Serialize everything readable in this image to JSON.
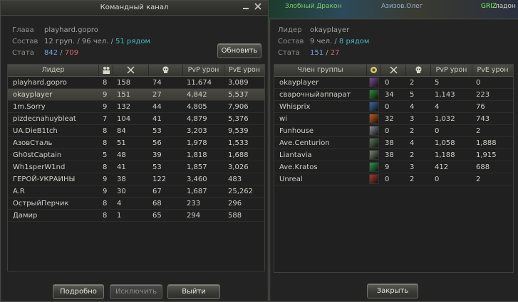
{
  "background": {
    "snippets": [
      "Злобный Дракон",
      "Азизов.Олег",
      "GRIZ",
      "ладон"
    ]
  },
  "left": {
    "title": "Командный канал",
    "info": {
      "leader_label": "Глава",
      "leader_value": "playhard.gopro",
      "composition_label": "Состав",
      "composition_value": "12 груп. / 96 чел. /",
      "composition_nearby": "51 рядом",
      "stats_label": "Стата",
      "stats_a": "842",
      "stats_sep": "/",
      "stats_b": "709"
    },
    "refresh_label": "Обновить",
    "columns": [
      "Лидер",
      "people-icon",
      "swords-icon",
      "skull-icon",
      "PvP урон",
      "PvE урон"
    ],
    "rows": [
      {
        "name": "playhard.gopro",
        "count": "8",
        "kills": "158",
        "deaths": "74",
        "pvp": "11,674",
        "pve": "3,089",
        "selected": false
      },
      {
        "name": "okayplayer",
        "count": "9",
        "kills": "151",
        "deaths": "27",
        "pvp": "4,842",
        "pve": "5,537",
        "selected": true
      },
      {
        "name": "1m.Sorry",
        "count": "9",
        "kills": "132",
        "deaths": "44",
        "pvp": "4,805",
        "pve": "7,906",
        "selected": false
      },
      {
        "name": "pizdecnahuybleat",
        "count": "7",
        "kills": "104",
        "deaths": "41",
        "pvp": "4,879",
        "pve": "5,376",
        "selected": false
      },
      {
        "name": "UA.DieB1tch",
        "count": "8",
        "kills": "84",
        "deaths": "53",
        "pvp": "3,203",
        "pve": "9,539",
        "selected": false
      },
      {
        "name": "АзовСталь",
        "count": "8",
        "kills": "51",
        "deaths": "56",
        "pvp": "1,978",
        "pve": "1,533",
        "selected": false
      },
      {
        "name": "Gh0stCaptain",
        "count": "5",
        "kills": "48",
        "deaths": "39",
        "pvp": "1,818",
        "pve": "1,688",
        "selected": false
      },
      {
        "name": "Wh1sperW1nd",
        "count": "8",
        "kills": "41",
        "deaths": "53",
        "pvp": "1,857",
        "pve": "3,026",
        "selected": false
      },
      {
        "name": "ГЕРОЙ-УКРАИНЫ",
        "count": "9",
        "kills": "38",
        "deaths": "122",
        "pvp": "3,460",
        "pve": "483",
        "selected": false
      },
      {
        "name": "A.R",
        "count": "9",
        "kills": "30",
        "deaths": "67",
        "pvp": "1,687",
        "pve": "25,262",
        "selected": false
      },
      {
        "name": "ОстрыйПерчик",
        "count": "8",
        "kills": "4",
        "deaths": "68",
        "pvp": "233",
        "pve": "296",
        "selected": false
      },
      {
        "name": "Дамир",
        "count": "8",
        "kills": "1",
        "deaths": "65",
        "pvp": "294",
        "pve": "588",
        "selected": false
      }
    ],
    "buttons": {
      "details": "Подробно",
      "kick": "Исключить",
      "leave": "Выйти"
    }
  },
  "right": {
    "info": {
      "leader_label": "Лидер",
      "leader_value": "okayplayer",
      "composition_label": "Состав",
      "composition_value": "9 чел. /",
      "composition_nearby": "8 рядом",
      "stats_label": "Стата",
      "stats_a": "151",
      "stats_sep": "/",
      "stats_b": "27"
    },
    "columns": [
      "Член группы",
      "class-icon",
      "swords-icon",
      "skull-icon",
      "PvP урон",
      "PvE урон"
    ],
    "rows": [
      {
        "name": "okayplayer",
        "class_color": "#7a4a9a",
        "kills": "0",
        "deaths": "2",
        "pvp": "5",
        "pve": "0"
      },
      {
        "name": "сварочныйаппарат",
        "class_color": "#2f8a3a",
        "kills": "34",
        "deaths": "5",
        "pvp": "1,143",
        "pve": "223"
      },
      {
        "name": "Whisprix",
        "class_color": "#3a6aa8",
        "kills": "0",
        "deaths": "4",
        "pvp": "4",
        "pve": "76"
      },
      {
        "name": "wi",
        "class_color": "#c85a1a",
        "kills": "32",
        "deaths": "3",
        "pvp": "1,032",
        "pve": "743"
      },
      {
        "name": "Funhouse",
        "class_color": "#8a8a9a",
        "kills": "0",
        "deaths": "2",
        "pvp": "0",
        "pve": "2"
      },
      {
        "name": "Ave.Centurion",
        "class_color": "#5a7a5a",
        "kills": "38",
        "deaths": "4",
        "pvp": "1,058",
        "pve": "1,888"
      },
      {
        "name": "Liantavia",
        "class_color": "#7a8a6a",
        "kills": "38",
        "deaths": "2",
        "pvp": "1,188",
        "pve": "1,915"
      },
      {
        "name": "Ave.Kratos",
        "class_color": "#2e9a4a",
        "kills": "9",
        "deaths": "3",
        "pvp": "412",
        "pve": "688"
      },
      {
        "name": "Unreal",
        "class_color": "#a83a2a",
        "kills": "0",
        "deaths": "2",
        "pvp": "0",
        "pve": "2"
      }
    ],
    "close_label": "Закрыть"
  }
}
